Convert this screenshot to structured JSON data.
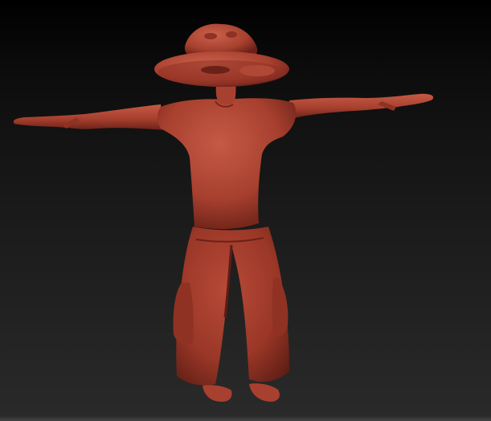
{
  "viewport": {
    "background_top": "#000000",
    "background_bottom": "#2a2a2a"
  },
  "model": {
    "description_icon": "character-mesh-icon",
    "pose": "T-pose",
    "material_color": "#a8402f",
    "highlight_color": "#c9614c",
    "shadow_color": "#5e1d14"
  }
}
